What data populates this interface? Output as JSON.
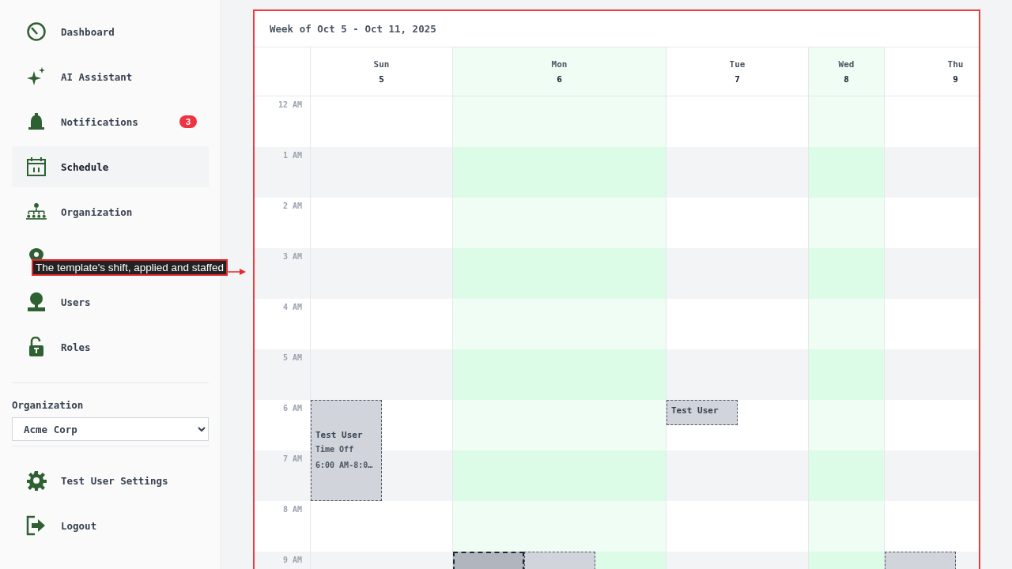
{
  "sidebar": {
    "nav_items": [
      {
        "label": "Dashboard",
        "selected": false
      },
      {
        "label": "AI Assistant",
        "selected": false
      },
      {
        "label": "Notifications",
        "selected": false,
        "badge": "3"
      },
      {
        "label": "Schedule",
        "selected": true
      },
      {
        "label": "Organization",
        "selected": false
      },
      {
        "selected": false
      },
      {
        "label": "Users",
        "selected": false
      },
      {
        "label": "Roles",
        "selected": false
      }
    ],
    "organization": {
      "label": "Organization",
      "value": "Acme Corp"
    },
    "footer_items": [
      {
        "label": "Test User Settings"
      },
      {
        "label": "Logout"
      }
    ]
  },
  "calendar": {
    "title": "Week of Oct 5 - Oct 11, 2025",
    "days": [
      {
        "name": "Sun",
        "date": "5",
        "highlighted": false
      },
      {
        "name": "Mon",
        "date": "6",
        "highlighted": true
      },
      {
        "name": "Tue",
        "date": "7",
        "highlighted": false
      },
      {
        "name": "Wed",
        "date": "8",
        "highlighted": true
      },
      {
        "name": "Thu",
        "date": "9",
        "highlighted": false
      }
    ],
    "rows": [
      {
        "label": "12 AM"
      },
      {
        "label": "1 AM"
      },
      {
        "label": "2 AM"
      },
      {
        "label": "3 AM"
      },
      {
        "label": "4 AM"
      },
      {
        "label": "5 AM"
      },
      {
        "label": "6 AM",
        "cells": [
          {
            "events": [
              {
                "kind": "time_off",
                "selected": false,
                "title": "Test User",
                "lines": [
                  "Time Off",
                  "6:00 AM-8:0…"
                ]
              }
            ]
          },
          {},
          {
            "events": [
              {
                "kind": "brief",
                "selected": false,
                "title": "Test User"
              }
            ]
          },
          {},
          {}
        ]
      },
      {
        "label": "7 AM"
      },
      {
        "label": "8 AM"
      },
      {
        "label": "9 AM",
        "cells": [
          {},
          {
            "events": [
              {
                "kind": "hour",
                "selected": true
              },
              {
                "kind": "hour",
                "selected": false
              }
            ]
          },
          {},
          {},
          {
            "events": [
              {
                "kind": "hour",
                "selected": false
              }
            ]
          }
        ]
      }
    ]
  },
  "annotation": {
    "label": "The template's shift, applied and staffed"
  }
}
